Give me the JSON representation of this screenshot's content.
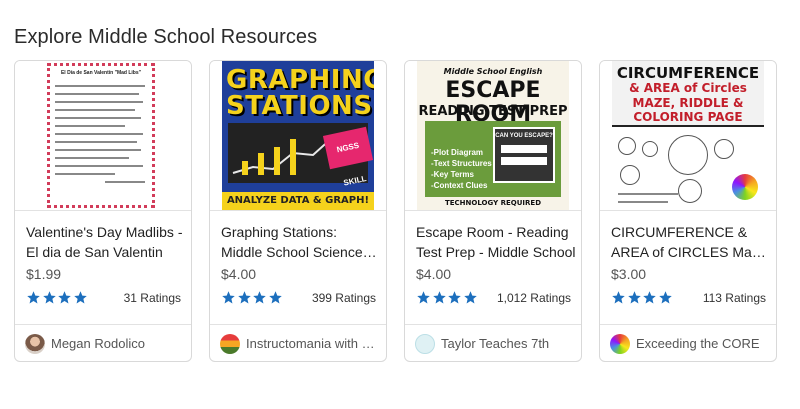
{
  "section": {
    "title": "Explore Middle School Resources"
  },
  "colors": {
    "star": "#1d6fbd",
    "text": "#222222",
    "muted": "#555555"
  },
  "cards": [
    {
      "title": "Valentine's Day Madlibs - El dia de San Valentin",
      "price": "$1.99",
      "rating": 4,
      "ratings_label": "31 Ratings",
      "seller": "Megan Rodolico",
      "cover_lines": [
        "El Día de San Valentín \"Mad Libs\""
      ]
    },
    {
      "title": "Graphing Stations: Middle School Science NGSS Skill",
      "price": "$4.00",
      "rating": 4,
      "ratings_label": "399 Ratings",
      "seller": "Instructomania with Mrs ...",
      "cover_lines": [
        "GRAPHING",
        "STATIONS",
        "ANALYZE DATA & GRAPH!",
        "NGSS SKILL"
      ]
    },
    {
      "title": "Escape Room - Reading Test Prep - Middle School",
      "price": "$4.00",
      "rating": 4,
      "ratings_label": "1,012 Ratings",
      "seller": "Taylor Teaches 7th",
      "cover_lines": [
        "Middle School English",
        "ESCAPE ROOM",
        "READING TEST PREP",
        "CAN YOU ESCAPE?",
        "-Plot Diagram",
        "-Text Structures",
        "-Key Terms",
        "-Context Clues",
        "TECHNOLOGY REQUIRED"
      ]
    },
    {
      "title": "CIRCUMFERENCE & AREA of CIRCLES Maze, Riddle, Coloring Page",
      "price": "$3.00",
      "rating": 4,
      "ratings_label": "113 Ratings",
      "seller": "Exceeding the CORE",
      "cover_lines": [
        "CIRCUMFERENCE",
        "& AREA of Circles",
        "MAZE, RIDDLE &",
        "COLORING PAGE"
      ]
    }
  ]
}
